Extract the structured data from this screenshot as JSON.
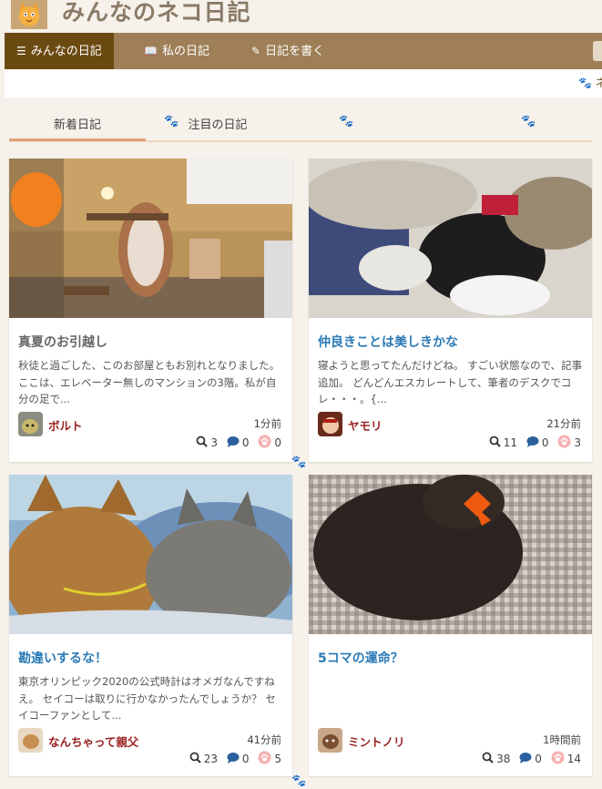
{
  "site": {
    "title": "みんなのネコ日記"
  },
  "nav": {
    "items": [
      {
        "label": "みんなの日記",
        "icon": "list-icon"
      },
      {
        "label": "私の日記",
        "icon": "book-icon"
      },
      {
        "label": "日記を書く",
        "icon": "edit-icon"
      }
    ]
  },
  "ticker": {
    "text": "ネ"
  },
  "tabs": [
    {
      "label": "新着日記"
    },
    {
      "label": "注目の日記"
    }
  ],
  "colors": {
    "nav_bg": "#9e7f57",
    "nav_active": "#6b4a12",
    "title_link": "#2a7ab5",
    "author": "#9a1f1f"
  },
  "cards": [
    {
      "title": "真夏のお引越し",
      "excerpt": "秋徒と過ごした、このお部屋ともお別れとなりました。 ここは、エレベーター無しのマンションの3階。私が自分の足で...",
      "author": "ボルト",
      "time": "1分前",
      "views": "3",
      "comments": "0",
      "likes": "0"
    },
    {
      "title": "仲良きことは美しきかな",
      "excerpt": "寝ようと思ってたんだけどね。 すごい状態なので、記事追加。 どんどんエスカレートして、筆者のデスクでコレ・・・。{...",
      "author": "ヤモリ",
      "time": "21分前",
      "views": "11",
      "comments": "0",
      "likes": "3"
    },
    {
      "title": "勘違いするな！",
      "excerpt": "東京オリンピック2020の公式時計はオメガなんですねえ。 セイコーは取りに行かなかったんでしょうか？ セイコーファンとして...",
      "author": "なんちゃって親父",
      "time": "41分前",
      "views": "23",
      "comments": "0",
      "likes": "5"
    },
    {
      "title": "5コマの運命？",
      "excerpt": "",
      "author": "ミントノリ",
      "time": "1時間前",
      "views": "38",
      "comments": "0",
      "likes": "14"
    }
  ]
}
